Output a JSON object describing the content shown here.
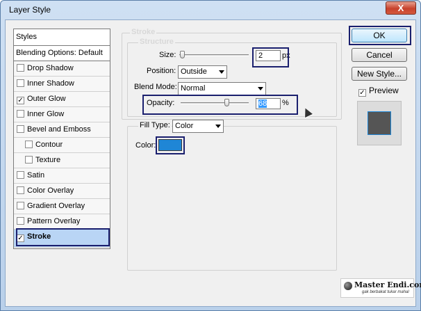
{
  "window": {
    "title": "Layer Style",
    "close_label": "X"
  },
  "styles_panel": {
    "header": "Styles",
    "blending_options": "Blending Options: Default",
    "items": [
      {
        "label": "Drop Shadow",
        "checked": false,
        "mark": ""
      },
      {
        "label": "Inner Shadow",
        "checked": false,
        "mark": ""
      },
      {
        "label": "Outer Glow",
        "checked": true,
        "mark": "✓"
      },
      {
        "label": "Inner Glow",
        "checked": false,
        "mark": ""
      },
      {
        "label": "Bevel and Emboss",
        "checked": false,
        "mark": ""
      },
      {
        "label": "Contour",
        "checked": false,
        "mark": ""
      },
      {
        "label": "Texture",
        "checked": false,
        "mark": ""
      },
      {
        "label": "Satin",
        "checked": false,
        "mark": ""
      },
      {
        "label": "Color Overlay",
        "checked": false,
        "mark": ""
      },
      {
        "label": "Gradient Overlay",
        "checked": false,
        "mark": ""
      },
      {
        "label": "Pattern Overlay",
        "checked": false,
        "mark": ""
      },
      {
        "label": "Stroke",
        "checked": true,
        "mark": "✓"
      }
    ]
  },
  "stroke": {
    "group_title": "Stroke",
    "structure_title": "Structure",
    "size_label": "Size:",
    "size_value": "2",
    "size_unit": "px",
    "position_label": "Position:",
    "position_value": "Outside",
    "blend_mode_label": "Blend Mode:",
    "blend_mode_value": "Normal",
    "opacity_label": "Opacity:",
    "opacity_value": "68",
    "opacity_unit": "%",
    "fill_type_label": "Fill Type:",
    "fill_type_value": "Color",
    "color_label": "Color:",
    "color_value": "#1f86d6"
  },
  "buttons": {
    "ok": "OK",
    "cancel": "Cancel",
    "new_style": "New Style...",
    "preview": "Preview",
    "preview_mark": "✓"
  },
  "watermark": {
    "name": "Master Endi.com",
    "tagline": "gak berbakat tukar mahal"
  }
}
